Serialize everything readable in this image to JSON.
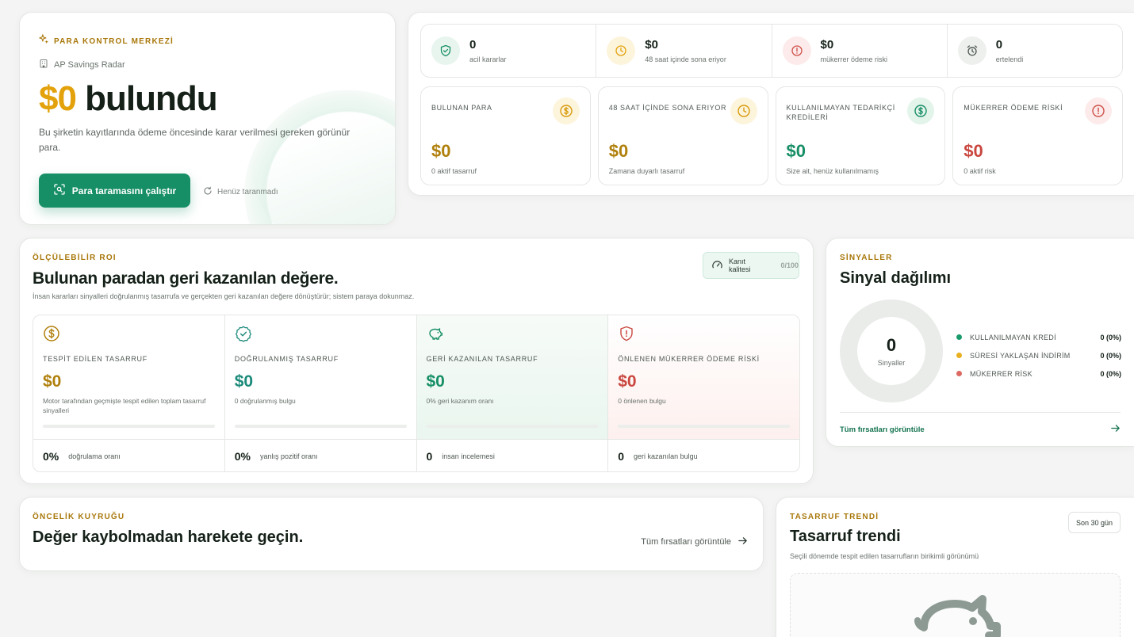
{
  "hero": {
    "eyebrow": "PARA KONTROL MERKEZİ",
    "app_name": "AP Savings Radar",
    "amount": "$0",
    "title_suffix": " bulundu",
    "description": "Bu şirketin kayıtlarında ödeme öncesinde karar verilmesi gereken görünür para.",
    "scan_button": "Para taramasını çalıştır",
    "scan_status": "Henüz taranmadı"
  },
  "summary_strip": [
    {
      "value": "0",
      "label": "acil kararlar",
      "icon": "shield-check-icon",
      "color": "#178f66"
    },
    {
      "value": "$0",
      "label": "48 saat içinde sona eriyor",
      "icon": "clock-icon",
      "color": "#e3a20c"
    },
    {
      "value": "$0",
      "label": "mükerrer ödeme riski",
      "icon": "alert-icon",
      "color": "#d0504a"
    },
    {
      "value": "0",
      "label": "ertelendi",
      "icon": "alarm-icon",
      "color": "#5d655f"
    }
  ],
  "metrics": [
    {
      "label": "BULUNAN PARA",
      "value": "$0",
      "sub": "0 aktif tasarruf",
      "icon": "dollar-icon",
      "color": "#b0800c"
    },
    {
      "label": "48 SAAT İÇİNDE SONA ERIYOR",
      "value": "$0",
      "sub": "Zamana duyarlı tasarruf",
      "icon": "clock-icon",
      "color": "#b0800c"
    },
    {
      "label": "KULLANILMAYAN TEDARİKÇİ KREDİLERİ",
      "value": "$0",
      "sub": "Size ait, henüz kullanılmamış",
      "icon": "dollar-icon",
      "color": "#178f66"
    },
    {
      "label": "MÜKERRER ÖDEME RİSKİ",
      "value": "$0",
      "sub": "0 aktif risk",
      "icon": "alert-icon",
      "color": "#c9473f"
    }
  ],
  "roi": {
    "eyebrow": "ÖLÇÜLEBİLİR ROI",
    "title": "Bulunan paradan geri kazanılan değere.",
    "description": "İnsan kararları sinyalleri doğrulanmış tasarrufa ve gerçekten geri kazanılan değere dönüştürür; sistem paraya dokunmaz.",
    "quality_label": "Kanıt kalitesi",
    "quality_score": "0/100",
    "columns": [
      {
        "label": "TESPİT EDİLEN TASARRUF",
        "value": "$0",
        "sub": "Motor tarafından geçmişte tespit edilen toplam tasarruf sinyalleri",
        "icon": "dollar-icon",
        "color": "#b0800c",
        "progress": 0
      },
      {
        "label": "DOĞRULANMIŞ TASARRUF",
        "value": "$0",
        "sub": "0 doğrulanmış bulgu",
        "icon": "check-circle-icon",
        "color": "#1b8a7a",
        "progress": 0
      },
      {
        "label": "GERİ KAZANILAN TASARRUF",
        "value": "$0",
        "sub": "0% geri kazanım oranı",
        "icon": "piggy-icon",
        "color": "#178f66",
        "progress": 0
      },
      {
        "label": "ÖNLENEN MÜKERRER ÖDEME RİSKİ",
        "value": "$0",
        "sub": "0 önlenen bulgu",
        "icon": "shield-alert-icon",
        "color": "#c9473f",
        "progress": 0
      }
    ],
    "footer": [
      {
        "value": "0%",
        "label": "doğrulama oranı"
      },
      {
        "value": "0%",
        "label": "yanlış pozitif oranı"
      },
      {
        "value": "0",
        "label": "insan incelemesi"
      },
      {
        "value": "0",
        "label": "geri kazanılan bulgu"
      }
    ]
  },
  "signals": {
    "eyebrow": "SİNYALLER",
    "title": "Sinyal dağılımı",
    "total": "0",
    "total_label": "Sinyaller",
    "legend": [
      {
        "name": "KULLANILMAYAN KREDİ",
        "value": "0 (0%)",
        "color": "#1a9b6c"
      },
      {
        "name": "SÜRESİ YAKLAŞAN İNDİRİM",
        "value": "0 (0%)",
        "color": "#e8b020"
      },
      {
        "name": "MÜKERRER RİSK",
        "value": "0 (0%)",
        "color": "#dc6a62"
      }
    ],
    "link": "Tüm fırsatları görüntüle"
  },
  "priority": {
    "eyebrow": "ÖNCELİK KUYRUĞU",
    "title": "Değer kaybolmadan harekete geçin.",
    "link": "Tüm fırsatları görüntüle"
  },
  "trend": {
    "eyebrow": "TASARRUF TRENDİ",
    "title": "Tasarruf trendi",
    "description": "Seçili dönemde tespit edilen tasarrufların birikimli görünümü",
    "range": "Son 30 gün"
  }
}
